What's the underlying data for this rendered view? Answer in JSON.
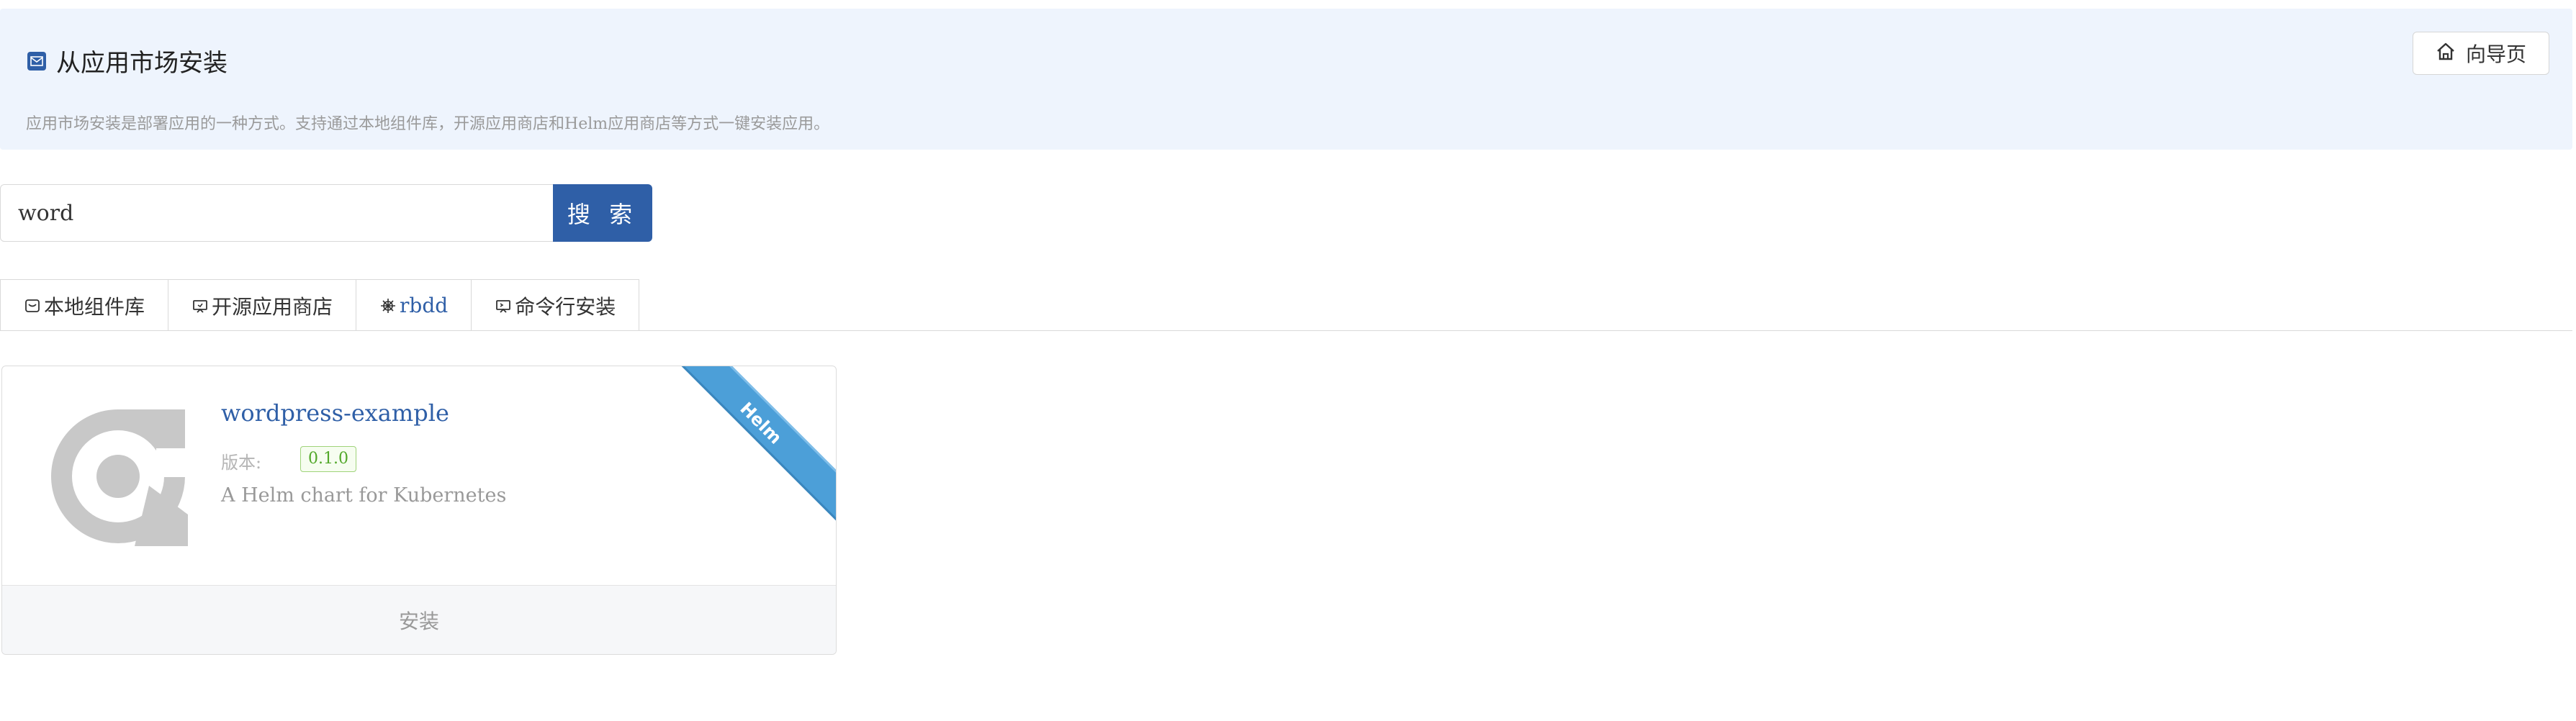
{
  "header": {
    "title": "从应用市场安装",
    "description": "应用市场安装是部署应用的一种方式。支持通过本地组件库，开源应用商店和Helm应用商店等方式一键安装应用。",
    "guide_button_label": "向导页"
  },
  "search": {
    "value": "word",
    "button_label": "搜 索"
  },
  "tabs": [
    {
      "label": "本地组件库",
      "icon": "local-library-icon",
      "active": false
    },
    {
      "label": "开源应用商店",
      "icon": "store-icon",
      "active": false
    },
    {
      "label": "rbdd",
      "icon": "helm-wheel-icon",
      "active": true
    },
    {
      "label": "命令行安装",
      "icon": "terminal-icon",
      "active": false
    }
  ],
  "cards": [
    {
      "name": "wordpress-example",
      "version_label": "版本:",
      "version": "0.1.0",
      "description": "A Helm chart for Kubernetes",
      "ribbon": "Helm",
      "install_label": "安装"
    }
  ],
  "colors": {
    "primary": "#2f5fa7",
    "header_bg": "#eef4fd",
    "ribbon": "#4c9fd8",
    "badge_green": "#52a82a"
  }
}
